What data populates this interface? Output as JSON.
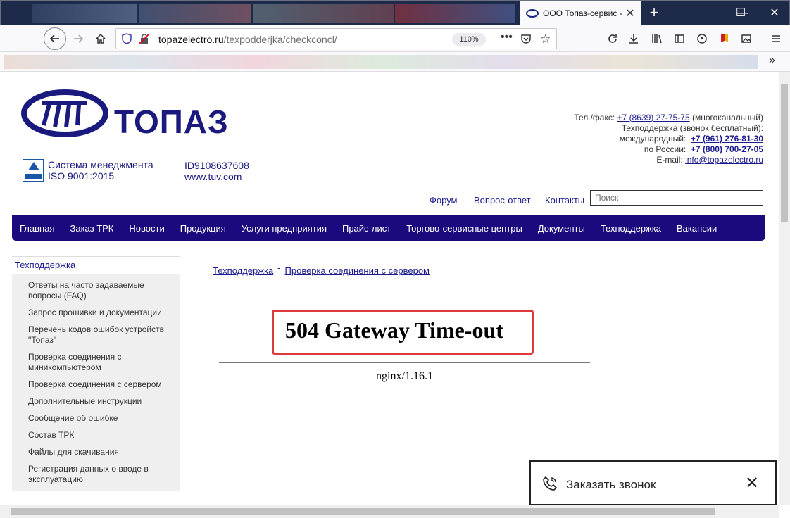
{
  "browser": {
    "tab_title": "ООО Топаз-сервис -",
    "tab_close": "✕",
    "new_tab": "+",
    "window_controls": [
      "—",
      "☐",
      "✕"
    ],
    "url_host": "topazelectro.ru",
    "url_path": "/texpodderjka/checkconcl/",
    "zoom": "110%",
    "icons": [
      "back-icon",
      "forward-icon",
      "home-icon",
      "shield-icon",
      "lock-icon",
      "reload-icon",
      "download-icon",
      "library-icon",
      "sidebar-icon",
      "account-icon",
      "extension-icon",
      "image-icon",
      "menu-icon",
      "more-bookmarks-icon"
    ]
  },
  "site": {
    "logo_text": "ТОПАЗ",
    "iso_line1": "Система менеджмента",
    "iso_line2": "ISO 9001:2015",
    "tuv_id": "ID9108637608",
    "tuv_site": "www.tuv.com",
    "contacts": {
      "tel_label": "Тел./факс:",
      "tel": "+7 (8639) 27-75-75",
      "tel_note": "(многоканальный)",
      "support_label": "Техподдержка (звонок бесплатный):",
      "intl_label": "международный:",
      "intl": "+7 (961) 276-81-30",
      "ru_label": "по России:",
      "ru": "+7 (800) 700-27-05",
      "email_label": "E-mail:",
      "email": "info@topazelectro.ru"
    },
    "toplinks": [
      "Форум",
      "Вопрос-ответ",
      "Контакты"
    ],
    "search_placeholder": "Поиск",
    "nav": [
      "Главная",
      "Заказ ТРК",
      "Новости",
      "Продукция",
      "Услуги предприятия",
      "Прайс-лист",
      "Торгово-сервисные центры",
      "Документы",
      "Техподдержка",
      "Вакансии"
    ],
    "sidebar": {
      "head": "Техподдержка",
      "items": [
        "Ответы на часто задаваемые вопросы (FAQ)",
        "Запрос прошивки и документации",
        "Перечень кодов ошибок устройств \"Топаз\"",
        "Проверка соединения с миникомпьютером",
        "Проверка соединения с сервером",
        "Дополнительные инструкции",
        "Сообщение об ошибке",
        "Состав ТРК",
        "Файлы для скачивания",
        "Регистрация данных о вводе в эксплуатацию"
      ]
    },
    "breadcrumb": [
      "Техподдержка",
      "Проверка соединения с сервером"
    ],
    "breadcrumb_sep": "-",
    "error_title": "504 Gateway Time-out",
    "error_server": "nginx/1.16.1",
    "callback_label": "Заказать звонок",
    "callback_close": "✕"
  }
}
